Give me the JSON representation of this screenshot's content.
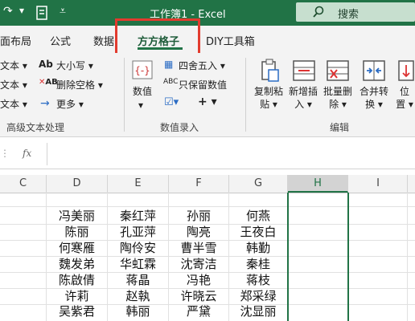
{
  "titlebar": {
    "doc_title": "工作簿1 - Excel",
    "search_label": "搜索"
  },
  "tabs": [
    {
      "label": "面布局"
    },
    {
      "label": "公式"
    },
    {
      "label": "数据"
    },
    {
      "label": "方方格子"
    },
    {
      "label": "DIY工具箱"
    }
  ],
  "ribbon": {
    "left_items": [
      "文本 ▾",
      "文本 ▾",
      "文本 ▾"
    ],
    "size_label": "大小写 ▾",
    "delete_space_label": "删除空格 ▾",
    "more_label": "更多 ▾",
    "group_text": "高级文本处理",
    "number_label": "数值",
    "round_label": "四舍五入 ▾",
    "keep_value_label": "只保留数值",
    "group_number": "数值录入",
    "copy_paste_label": "复制粘贴 ▾",
    "insert_label": "新增插入 ▾",
    "batch_delete_label": "批量删除 ▾",
    "merge_label": "合并转换 ▾",
    "position_label": "位 置 ▾",
    "group_edit": "编辑"
  },
  "formula_bar": {
    "fx": "fx"
  },
  "columns": [
    "C",
    "D",
    "E",
    "F",
    "G",
    "H",
    "I"
  ],
  "rows": [
    [
      "冯美丽",
      "秦红萍",
      "孙丽",
      "何燕"
    ],
    [
      "陈丽",
      "孔亚萍",
      "陶亮",
      "王夜白"
    ],
    [
      "何寒雁",
      "陶伶安",
      "曹半雪",
      "韩勤"
    ],
    [
      "魏发弟",
      "华虹霖",
      "沈寄洁",
      "秦桂"
    ],
    [
      "陈啟倩",
      "蒋晶",
      "冯艳",
      "蒋枝"
    ],
    [
      "许莉",
      "赵執",
      "许晓云",
      "郑采绿"
    ],
    [
      "吴紫君",
      "韩丽",
      "严黛",
      "沈显丽"
    ]
  ],
  "colors": {
    "brand": "#217346",
    "highlight_box": "#e23b2e",
    "selected_cell": "#217346"
  }
}
